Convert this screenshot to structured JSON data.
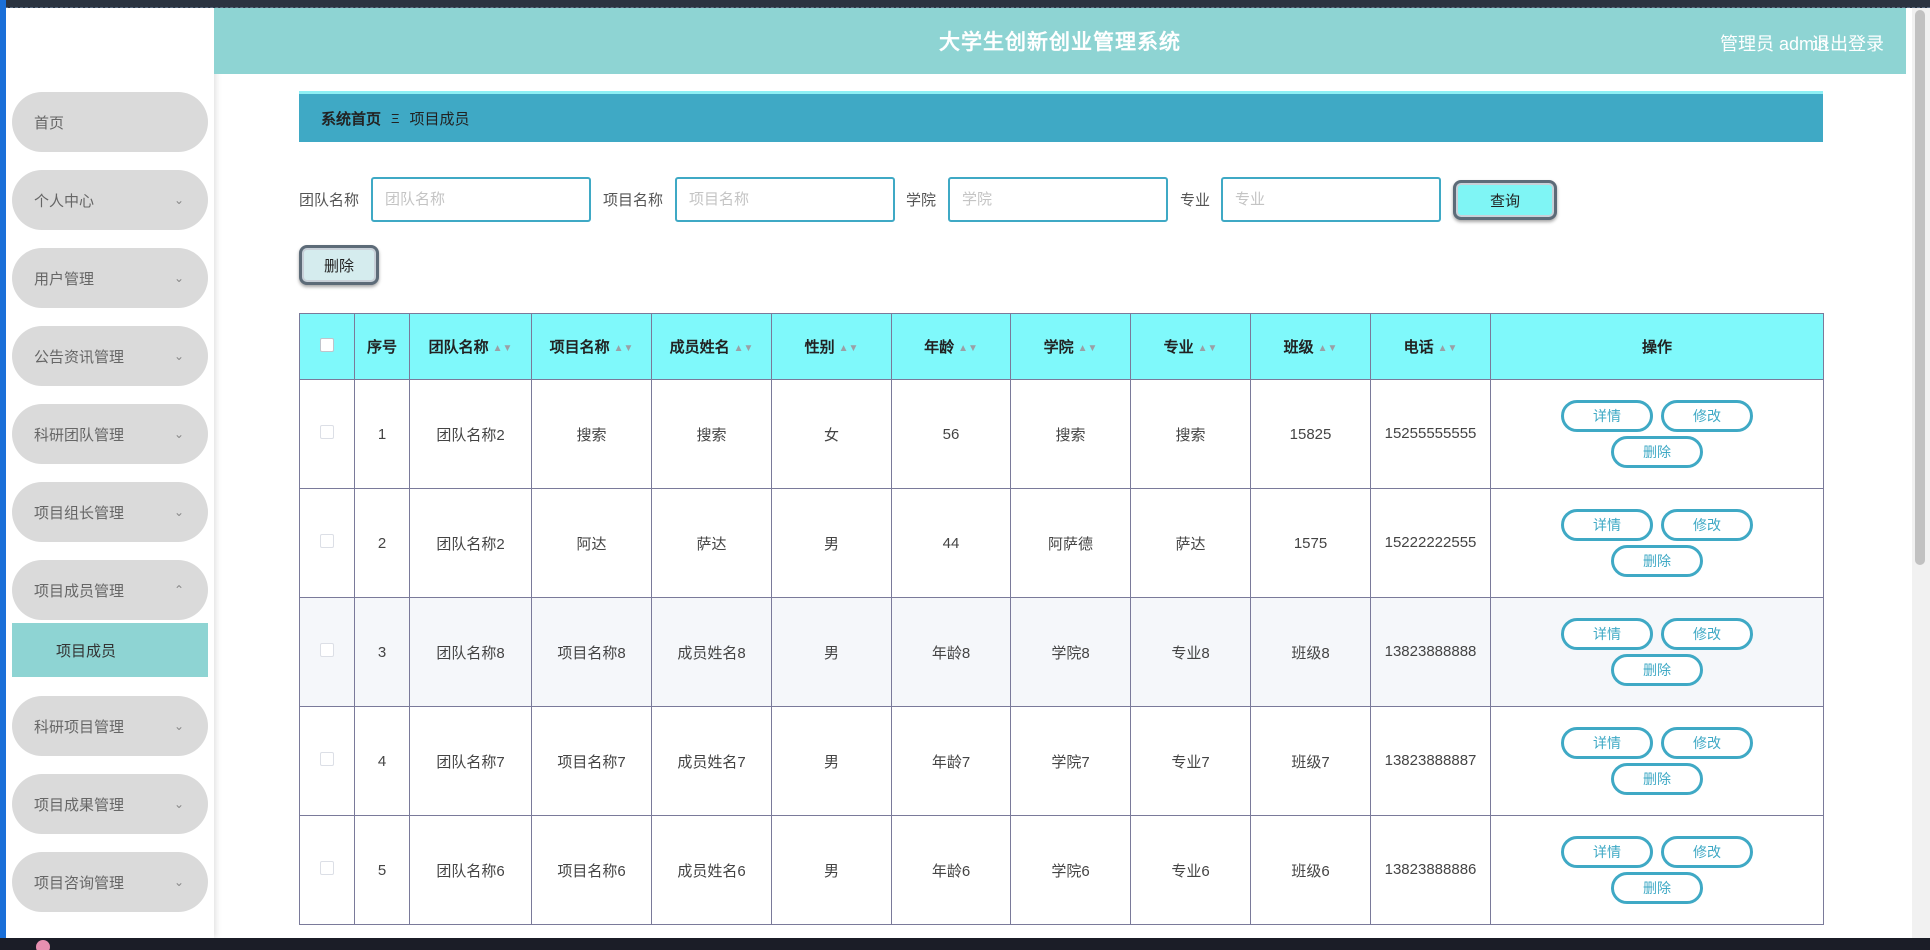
{
  "header": {
    "title": "大学生创新创业管理系统",
    "user": "管理员 admin",
    "logout": "退出登录"
  },
  "sidebar": {
    "items": [
      {
        "label": "首页",
        "chevron": ""
      },
      {
        "label": "个人中心",
        "chevron": "chevron-down"
      },
      {
        "label": "用户管理",
        "chevron": "chevron-down"
      },
      {
        "label": "公告资讯管理",
        "chevron": "chevron-down"
      },
      {
        "label": "科研团队管理",
        "chevron": "chevron-down"
      },
      {
        "label": "项目组长管理",
        "chevron": "chevron-down"
      },
      {
        "label": "项目成员管理",
        "chevron": "chevron-up"
      },
      {
        "label": "科研项目管理",
        "chevron": "chevron-down"
      },
      {
        "label": "项目成果管理",
        "chevron": "chevron-down"
      },
      {
        "label": "项目咨询管理",
        "chevron": "chevron-down"
      }
    ],
    "active_sub": "项目成员"
  },
  "breadcrumb": {
    "home": "系统首页",
    "separator": "Ξ",
    "current": "项目成员"
  },
  "search": {
    "team_label": "团队名称",
    "team_placeholder": "团队名称",
    "project_label": "项目名称",
    "project_placeholder": "项目名称",
    "college_label": "学院",
    "college_placeholder": "学院",
    "major_label": "专业",
    "major_placeholder": "专业",
    "query_button": "查询"
  },
  "toolbar": {
    "delete_button": "删除"
  },
  "table": {
    "headers": [
      "序号",
      "团队名称",
      "项目名称",
      "成员姓名",
      "性别",
      "年龄",
      "学院",
      "专业",
      "班级",
      "电话",
      "操作"
    ],
    "rows": [
      {
        "no": "1",
        "team": "团队名称2",
        "project": "搜索",
        "member": "搜索",
        "gender": "女",
        "age": "56",
        "college": "搜索",
        "major": "搜索",
        "class": "15825",
        "phone": "15255555555"
      },
      {
        "no": "2",
        "team": "团队名称2",
        "project": "阿达",
        "member": "萨达",
        "gender": "男",
        "age": "44",
        "college": "阿萨德",
        "major": "萨达",
        "class": "1575",
        "phone": "15222222555"
      },
      {
        "no": "3",
        "team": "团队名称8",
        "project": "项目名称8",
        "member": "成员姓名8",
        "gender": "男",
        "age": "年龄8",
        "college": "学院8",
        "major": "专业8",
        "class": "班级8",
        "phone": "13823888888"
      },
      {
        "no": "4",
        "team": "团队名称7",
        "project": "项目名称7",
        "member": "成员姓名7",
        "gender": "男",
        "age": "年龄7",
        "college": "学院7",
        "major": "专业7",
        "class": "班级7",
        "phone": "13823888887"
      },
      {
        "no": "5",
        "team": "团队名称6",
        "project": "项目名称6",
        "member": "成员姓名6",
        "gender": "男",
        "age": "年龄6",
        "college": "学院6",
        "major": "专业6",
        "class": "班级6",
        "phone": "13823888886"
      }
    ],
    "actions": {
      "detail": "详情",
      "edit": "修改",
      "delete": "删除"
    }
  },
  "colors": {
    "header_bg": "#8ed4d3",
    "breadcrumb_bg": "#3fa9c5",
    "table_header_bg": "#7ff9fb",
    "accent": "#3fa9c5"
  }
}
